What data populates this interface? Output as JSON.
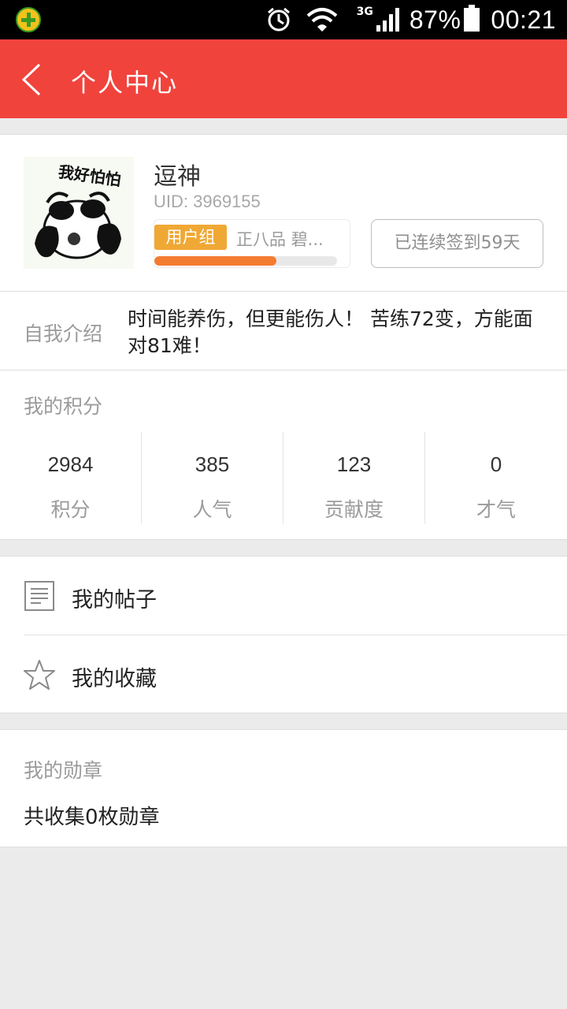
{
  "status_bar": {
    "battery": "87%",
    "time": "00:21",
    "network": "3G",
    "icons": [
      "app-icon",
      "alarm-icon",
      "wifi-icon",
      "signal-icon",
      "battery-icon"
    ]
  },
  "app_bar": {
    "title": "个人中心",
    "background": "#f0433c"
  },
  "profile": {
    "avatar_caption": "我好怕怕",
    "nickname": "逗神",
    "uid": "UID: 3969155",
    "group_badge": "用户组",
    "group_rank": "正八品 碧...",
    "level_progress": 0.67,
    "checkin_label": "已连续签到59天"
  },
  "intro": {
    "label": "自我介绍",
    "text": "时间能养伤，但更能伤人！ 苦练72变，方能面对81难！"
  },
  "points": {
    "title": "我的积分",
    "stats": [
      {
        "value": "2984",
        "label": "积分"
      },
      {
        "value": "385",
        "label": "人气"
      },
      {
        "value": "123",
        "label": "贡献度"
      },
      {
        "value": "0",
        "label": "才气"
      }
    ]
  },
  "menu": {
    "posts_label": "我的帖子",
    "favorites_label": "我的收藏"
  },
  "medals": {
    "title": "我的勋章",
    "count_text": "共收集0枚勋章"
  },
  "colors": {
    "accent": "#f0433c",
    "badge": "#f0a835",
    "progress": "#f47c31"
  }
}
